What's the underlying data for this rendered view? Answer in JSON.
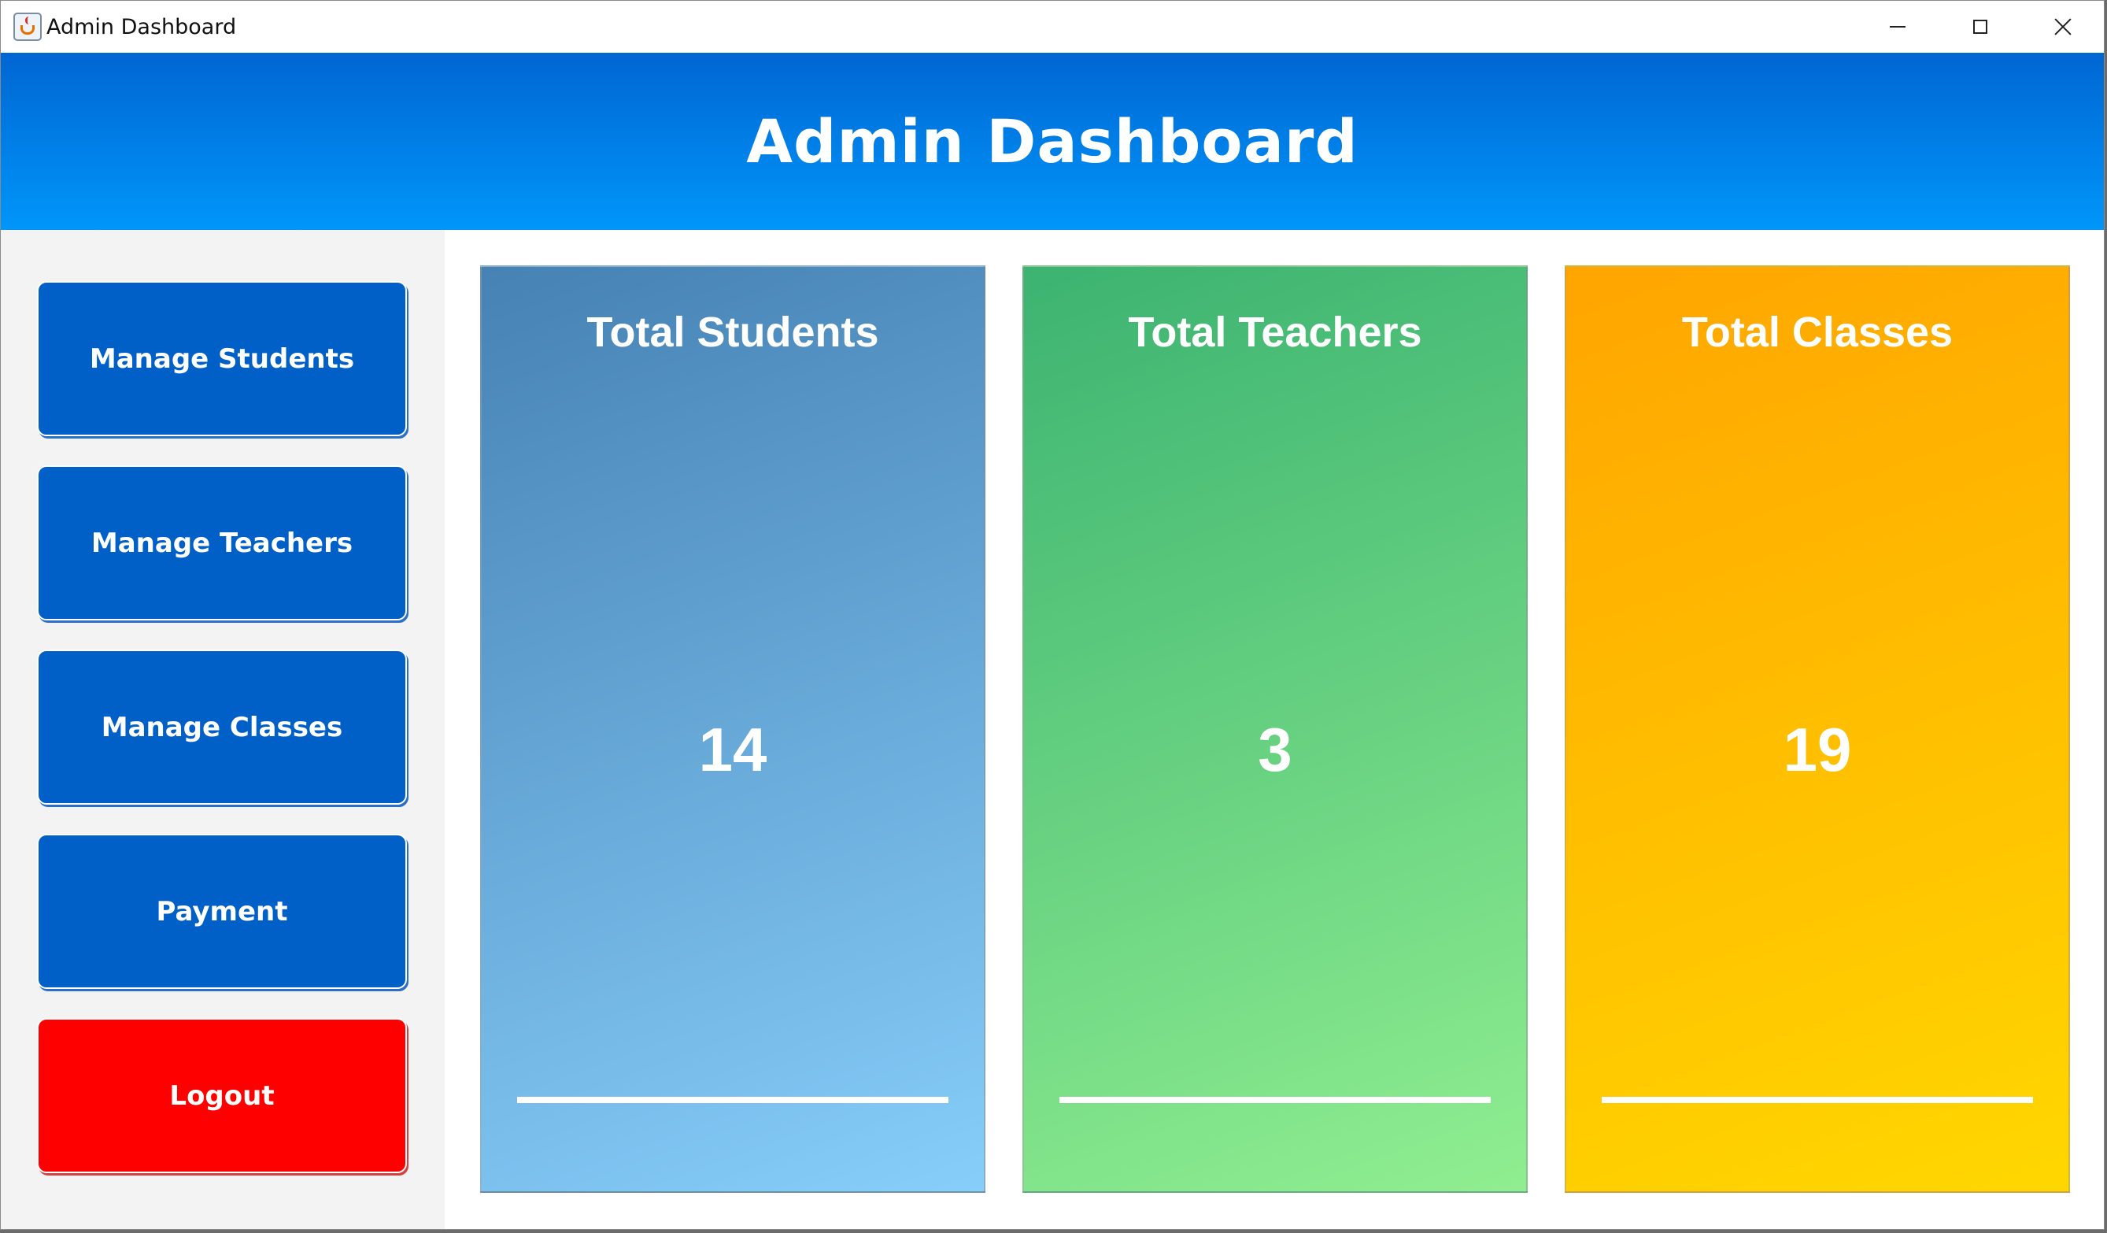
{
  "window": {
    "title": "Admin Dashboard",
    "app_icon": "java-cup-icon"
  },
  "header": {
    "title": "Admin Dashboard",
    "gradient": [
      "#0066d2",
      "#0096fa"
    ]
  },
  "sidebar": {
    "items": [
      {
        "label": "Manage Students",
        "color": "#0060c8"
      },
      {
        "label": "Manage Teachers",
        "color": "#0060c8"
      },
      {
        "label": "Manage Classes",
        "color": "#0060c8"
      },
      {
        "label": "Payment",
        "color": "#0060c8"
      },
      {
        "label": "Logout",
        "color": "#ff0000"
      }
    ]
  },
  "stats": [
    {
      "title": "Total Students",
      "value": "14",
      "colors": [
        "#4682b4",
        "#87cefa"
      ]
    },
    {
      "title": "Total Teachers",
      "value": "3",
      "colors": [
        "#3cb371",
        "#90ee90"
      ]
    },
    {
      "title": "Total Classes",
      "value": "19",
      "colors": [
        "#ffa500",
        "#ffd700"
      ]
    }
  ]
}
